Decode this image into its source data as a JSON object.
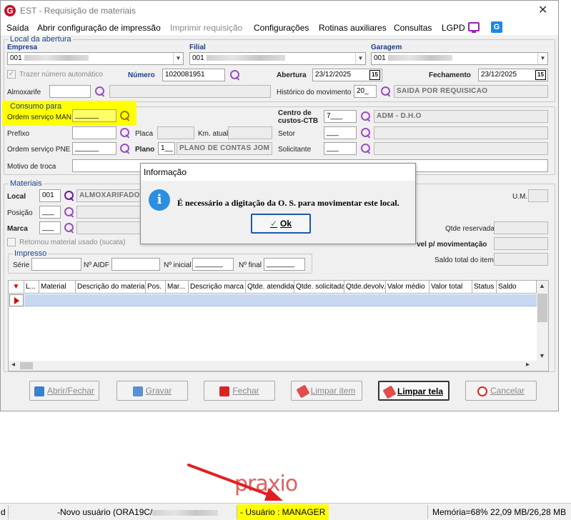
{
  "window": {
    "title": "EST - Requisição de materiais",
    "close_glyph": "✕",
    "logo_letter": "G"
  },
  "menu": {
    "items": [
      "Saída",
      "Abrir configuração de impressão",
      "Imprimir requisição",
      "Configurações",
      "Rotinas auxiliares",
      "Consultas",
      "LGPD"
    ],
    "disabled": [
      false,
      false,
      true,
      false,
      false,
      false,
      false
    ],
    "icons": [
      "monitor-icon",
      "g-app-icon"
    ]
  },
  "local_abertura": {
    "legend": "Local da abertura",
    "empresa_label": "Empresa",
    "empresa_value": "001",
    "filial_label": "Filial",
    "filial_value": "001",
    "garagem_label": "Garagem",
    "garagem_value": "001",
    "trazer_numero_label": "Trazer número automático",
    "numero_label": "Número",
    "numero_value": "1020081951",
    "abertura_label": "Abertura",
    "abertura_value": "23/12/2025",
    "fechamento_label": "Fechamento",
    "fechamento_value": "23/12/2025",
    "calendar_glyph": "15",
    "almoxarife_label": "Almoxarife",
    "historico_label": "Histórico do movimento",
    "historico_code": "20_",
    "historico_desc": "SAIDA POR REQUISICAO"
  },
  "consumo": {
    "legend": "Consumo para",
    "os_man_label": "Ordem serviço MAN",
    "os_man_value": "______",
    "centro_label_1": "Centro de",
    "centro_label_2": "custos-CTB",
    "centro_code": "7___",
    "centro_desc": "ADM - D.H.O",
    "prefixo_label": "Prefixo",
    "placa_label": "Placa",
    "km_label": "Km. atual",
    "setor_label": "Setor",
    "setor_code": "___",
    "os_pne_label": "Ordem serviço PNE",
    "os_pne_value": "______",
    "plano_label": "Plano",
    "plano_code": "1__",
    "plano_desc": "PLANO DE CONTAS JOM",
    "solicitante_label": "Solicitante",
    "solicitante_code": "___",
    "motivo_label": "Motivo de troca"
  },
  "materiais": {
    "legend": "Materiais",
    "local_label": "Local",
    "local_code": "001",
    "local_desc": "ALMOXARIFADO",
    "posicao_label": "Posição",
    "posicao_value": "___",
    "marca_label": "Marca",
    "marca_value": "___",
    "um_label": "U.M.",
    "qtde_reservada_label": "Qtde reservada",
    "disponivel_label": "vel p/ movimentação",
    "saldo_total_label": "Saldo total do item",
    "retornou_label": "Retornou material usado (sucata)",
    "impresso_legend": "Impresso",
    "serie_label": "Série",
    "aidf_label": "Nº AIDF",
    "inicial_label": "Nº inicial",
    "inicial_value": "_______",
    "final_label": "Nº final",
    "final_value": "_______"
  },
  "grid": {
    "columns": [
      "L...",
      "Material",
      "Descrição do material",
      "Pos.",
      "Mar...",
      "Descrição marca",
      "Qtde. atendida",
      "Qtde. solicitada",
      "Qtde.devolv.",
      "Valor médio",
      "Valor total",
      "Status",
      "Saldo"
    ]
  },
  "buttons": {
    "abrir_fechar": "Abrir/Fechar",
    "gravar": "Gravar",
    "fechar": "Fechar",
    "limpar_item": "Limpar item",
    "limpar_tela": "Limpar tela",
    "cancelar": "Cancelar"
  },
  "dialog": {
    "title": "Informação",
    "icon": "info-icon",
    "message": "É necessário a digitação da O. S. para movimentar este local.",
    "ok_label": "Ok",
    "ok_check": "✓"
  },
  "watermark": "praxio",
  "status": {
    "left_fragment": "d",
    "novo_usuario": "-Novo usuário (ORA19C/",
    "usuario": "- Usuário : MANAGER",
    "memoria": "Memória=68% 22,09 MB/26,28 MB"
  },
  "colors": {
    "highlight": "#ffff00",
    "legend_blue": "#1a3f8a",
    "accent_purple": "#9b4fc0",
    "dialog_border_blue": "#1c57b5",
    "info_blue": "#2a8fdf",
    "arrow_red": "#e02020"
  }
}
